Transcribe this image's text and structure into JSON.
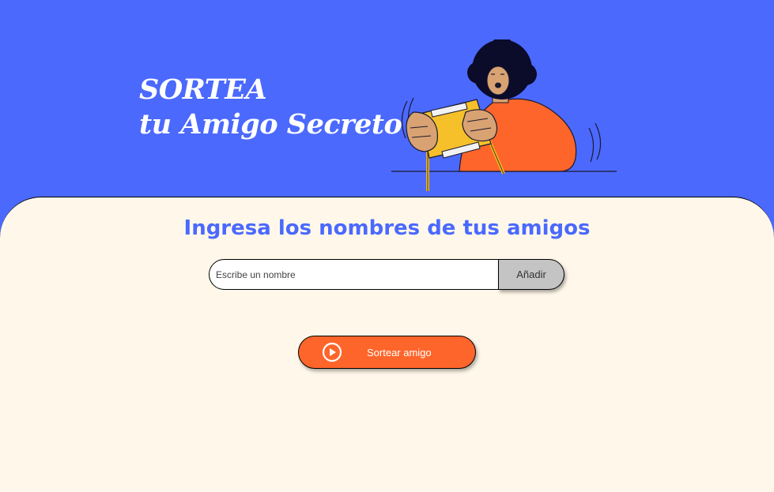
{
  "header": {
    "title_line1": "SORTEA",
    "title_line2": "tu Amigo Secreto",
    "illustration_icon": "person-holding-gift-illustration"
  },
  "main": {
    "title": "Ingresa los nombres de tus amigos",
    "input": {
      "placeholder": "Escribe un nombre",
      "value": ""
    },
    "add_button_label": "Añadir",
    "draw_button_label": "Sortear amigo",
    "draw_button_icon": "play-circle-icon"
  },
  "colors": {
    "header_bg": "#4B69FD",
    "main_bg": "#FFF8EA",
    "accent_orange": "#FE652B",
    "title_blue": "#4B69FD",
    "add_button_bg": "#C4C4C4"
  }
}
